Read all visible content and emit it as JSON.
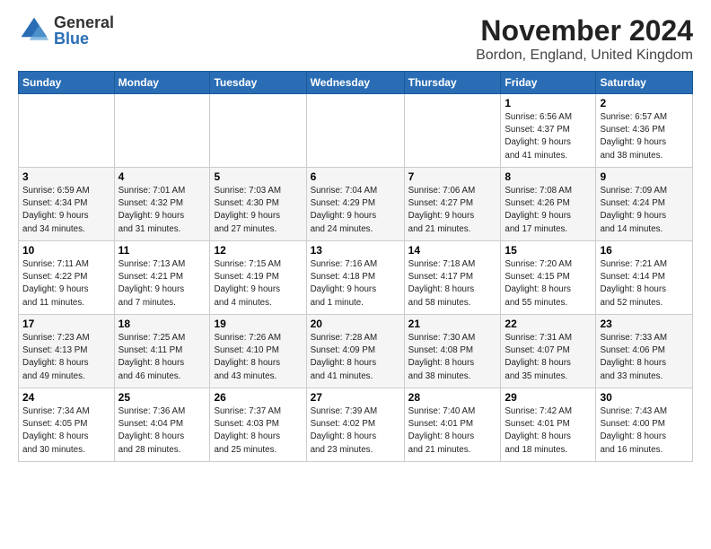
{
  "header": {
    "title": "November 2024",
    "subtitle": "Bordon, England, United Kingdom",
    "logo_general": "General",
    "logo_blue": "Blue"
  },
  "days_of_week": [
    "Sunday",
    "Monday",
    "Tuesday",
    "Wednesday",
    "Thursday",
    "Friday",
    "Saturday"
  ],
  "weeks": [
    [
      {
        "day": "",
        "info": ""
      },
      {
        "day": "",
        "info": ""
      },
      {
        "day": "",
        "info": ""
      },
      {
        "day": "",
        "info": ""
      },
      {
        "day": "",
        "info": ""
      },
      {
        "day": "1",
        "info": "Sunrise: 6:56 AM\nSunset: 4:37 PM\nDaylight: 9 hours\nand 41 minutes."
      },
      {
        "day": "2",
        "info": "Sunrise: 6:57 AM\nSunset: 4:36 PM\nDaylight: 9 hours\nand 38 minutes."
      }
    ],
    [
      {
        "day": "3",
        "info": "Sunrise: 6:59 AM\nSunset: 4:34 PM\nDaylight: 9 hours\nand 34 minutes."
      },
      {
        "day": "4",
        "info": "Sunrise: 7:01 AM\nSunset: 4:32 PM\nDaylight: 9 hours\nand 31 minutes."
      },
      {
        "day": "5",
        "info": "Sunrise: 7:03 AM\nSunset: 4:30 PM\nDaylight: 9 hours\nand 27 minutes."
      },
      {
        "day": "6",
        "info": "Sunrise: 7:04 AM\nSunset: 4:29 PM\nDaylight: 9 hours\nand 24 minutes."
      },
      {
        "day": "7",
        "info": "Sunrise: 7:06 AM\nSunset: 4:27 PM\nDaylight: 9 hours\nand 21 minutes."
      },
      {
        "day": "8",
        "info": "Sunrise: 7:08 AM\nSunset: 4:26 PM\nDaylight: 9 hours\nand 17 minutes."
      },
      {
        "day": "9",
        "info": "Sunrise: 7:09 AM\nSunset: 4:24 PM\nDaylight: 9 hours\nand 14 minutes."
      }
    ],
    [
      {
        "day": "10",
        "info": "Sunrise: 7:11 AM\nSunset: 4:22 PM\nDaylight: 9 hours\nand 11 minutes."
      },
      {
        "day": "11",
        "info": "Sunrise: 7:13 AM\nSunset: 4:21 PM\nDaylight: 9 hours\nand 7 minutes."
      },
      {
        "day": "12",
        "info": "Sunrise: 7:15 AM\nSunset: 4:19 PM\nDaylight: 9 hours\nand 4 minutes."
      },
      {
        "day": "13",
        "info": "Sunrise: 7:16 AM\nSunset: 4:18 PM\nDaylight: 9 hours\nand 1 minute."
      },
      {
        "day": "14",
        "info": "Sunrise: 7:18 AM\nSunset: 4:17 PM\nDaylight: 8 hours\nand 58 minutes."
      },
      {
        "day": "15",
        "info": "Sunrise: 7:20 AM\nSunset: 4:15 PM\nDaylight: 8 hours\nand 55 minutes."
      },
      {
        "day": "16",
        "info": "Sunrise: 7:21 AM\nSunset: 4:14 PM\nDaylight: 8 hours\nand 52 minutes."
      }
    ],
    [
      {
        "day": "17",
        "info": "Sunrise: 7:23 AM\nSunset: 4:13 PM\nDaylight: 8 hours\nand 49 minutes."
      },
      {
        "day": "18",
        "info": "Sunrise: 7:25 AM\nSunset: 4:11 PM\nDaylight: 8 hours\nand 46 minutes."
      },
      {
        "day": "19",
        "info": "Sunrise: 7:26 AM\nSunset: 4:10 PM\nDaylight: 8 hours\nand 43 minutes."
      },
      {
        "day": "20",
        "info": "Sunrise: 7:28 AM\nSunset: 4:09 PM\nDaylight: 8 hours\nand 41 minutes."
      },
      {
        "day": "21",
        "info": "Sunrise: 7:30 AM\nSunset: 4:08 PM\nDaylight: 8 hours\nand 38 minutes."
      },
      {
        "day": "22",
        "info": "Sunrise: 7:31 AM\nSunset: 4:07 PM\nDaylight: 8 hours\nand 35 minutes."
      },
      {
        "day": "23",
        "info": "Sunrise: 7:33 AM\nSunset: 4:06 PM\nDaylight: 8 hours\nand 33 minutes."
      }
    ],
    [
      {
        "day": "24",
        "info": "Sunrise: 7:34 AM\nSunset: 4:05 PM\nDaylight: 8 hours\nand 30 minutes."
      },
      {
        "day": "25",
        "info": "Sunrise: 7:36 AM\nSunset: 4:04 PM\nDaylight: 8 hours\nand 28 minutes."
      },
      {
        "day": "26",
        "info": "Sunrise: 7:37 AM\nSunset: 4:03 PM\nDaylight: 8 hours\nand 25 minutes."
      },
      {
        "day": "27",
        "info": "Sunrise: 7:39 AM\nSunset: 4:02 PM\nDaylight: 8 hours\nand 23 minutes."
      },
      {
        "day": "28",
        "info": "Sunrise: 7:40 AM\nSunset: 4:01 PM\nDaylight: 8 hours\nand 21 minutes."
      },
      {
        "day": "29",
        "info": "Sunrise: 7:42 AM\nSunset: 4:01 PM\nDaylight: 8 hours\nand 18 minutes."
      },
      {
        "day": "30",
        "info": "Sunrise: 7:43 AM\nSunset: 4:00 PM\nDaylight: 8 hours\nand 16 minutes."
      }
    ]
  ]
}
